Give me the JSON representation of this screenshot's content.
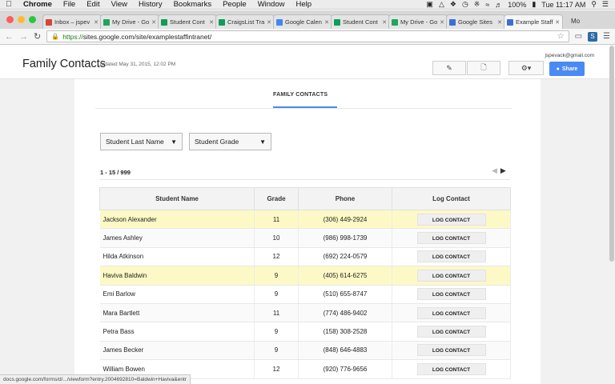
{
  "menubar": {
    "app": "Chrome",
    "items": [
      "File",
      "Edit",
      "View",
      "History",
      "Bookmarks",
      "People",
      "Window",
      "Help"
    ],
    "battery": "100%",
    "clock": "Tue 11:17 AM"
  },
  "tabs": [
    {
      "label": "Inbox – jspev",
      "color": "#d44638",
      "active": false
    },
    {
      "label": "My Drive - Go",
      "color": "#1fa463",
      "active": false
    },
    {
      "label": "Student Cont",
      "color": "#0f9d58",
      "active": false
    },
    {
      "label": "CraigsList Tra",
      "color": "#0f9d58",
      "active": false
    },
    {
      "label": "Google Calen",
      "color": "#4285f4",
      "active": false
    },
    {
      "label": "Student Cont",
      "color": "#0f9d58",
      "active": false
    },
    {
      "label": "My Drive - Go",
      "color": "#1fa463",
      "active": false
    },
    {
      "label": "Google Sites",
      "color": "#3b6fd6",
      "active": false
    },
    {
      "label": "Example Staff",
      "color": "#3b6fd6",
      "active": true
    }
  ],
  "tab_extra": "Mo",
  "address": {
    "scheme": "https://",
    "rest": "sites.google.com/site/examplestaffintranet/"
  },
  "site": {
    "title": "Family Contacts",
    "updated": "Updated May 31, 2015, 12:02 PM",
    "user_email": "jspevack@gmail.com",
    "share_label": "Share"
  },
  "page_tab": "FAMILY CONTACTS",
  "filters": {
    "last_name": "Student Last Name",
    "grade": "Student Grade"
  },
  "pager": {
    "range": "1 - 15 / 999"
  },
  "table": {
    "headers": [
      "Student Name",
      "Grade",
      "Phone",
      "Log Contact"
    ],
    "button_label": "LOG CONTACT",
    "rows": [
      {
        "name": "Jackson Alexander",
        "grade": "11",
        "phone": "(306) 449-2924",
        "highlight": true
      },
      {
        "name": "James Ashley",
        "grade": "10",
        "phone": "(986) 998-1739",
        "highlight": false
      },
      {
        "name": "Hilda Atkinson",
        "grade": "12",
        "phone": "(692) 224-0579",
        "highlight": false
      },
      {
        "name": "Haviva Baldwin",
        "grade": "9",
        "phone": "(405) 614-6275",
        "highlight": true
      },
      {
        "name": "Emi Barlow",
        "grade": "9",
        "phone": "(510) 655-8747",
        "highlight": false
      },
      {
        "name": "Mara Bartlett",
        "grade": "11",
        "phone": "(774) 486-9402",
        "highlight": false
      },
      {
        "name": "Petra Bass",
        "grade": "9",
        "phone": "(158) 308-2528",
        "highlight": false
      },
      {
        "name": "James Becker",
        "grade": "9",
        "phone": "(848) 646-4883",
        "highlight": false
      },
      {
        "name": "William Bowen",
        "grade": "12",
        "phone": "(920) 776-9656",
        "highlight": false
      }
    ]
  },
  "status_url": "docs.google.com/forms/d/.../viewform?entry.2004692810=Baldwin+Haviva&entr"
}
